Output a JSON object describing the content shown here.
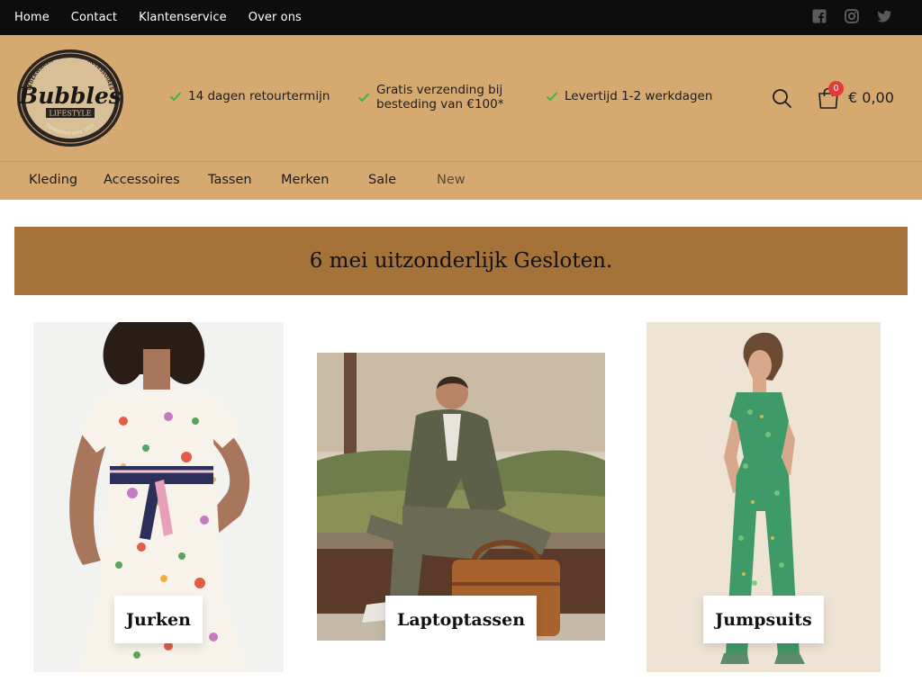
{
  "topbar": {
    "links": [
      "Home",
      "Contact",
      "Klantenservice",
      "Over ons"
    ],
    "social_icons": [
      "facebook-icon",
      "instagram-icon",
      "twitter-icon"
    ]
  },
  "header": {
    "logo": {
      "main": "Bubbles",
      "sub": "LIFESTYLE",
      "arc_top": "LEDERWAREN · KLEDING · ACCESSOIRES",
      "arc_bottom": "Established since 2017"
    },
    "usps": [
      "14 dagen retourtermijn",
      "Gratis verzending bij besteding van €100*",
      "Levertijd 1-2 werkdagen"
    ],
    "usp2_line1": "Gratis verzending bij",
    "usp2_line2": "besteding van €100*",
    "cart_count": "0",
    "cart_total": "€ 0,00"
  },
  "nav": {
    "items": [
      "Kleding",
      "Accessoires",
      "Tassen",
      "Merken",
      "Sale",
      "New"
    ]
  },
  "banner": {
    "text": "6 mei uitzonderlijk Gesloten."
  },
  "categories": [
    "Jurken",
    "Laptoptassen",
    "Jumpsuits"
  ],
  "colors": {
    "topbar": "#0d0d0d",
    "header": "#d5a96f",
    "banner": "#a5733a",
    "check": "#3bb54a",
    "badge": "#e53935"
  }
}
